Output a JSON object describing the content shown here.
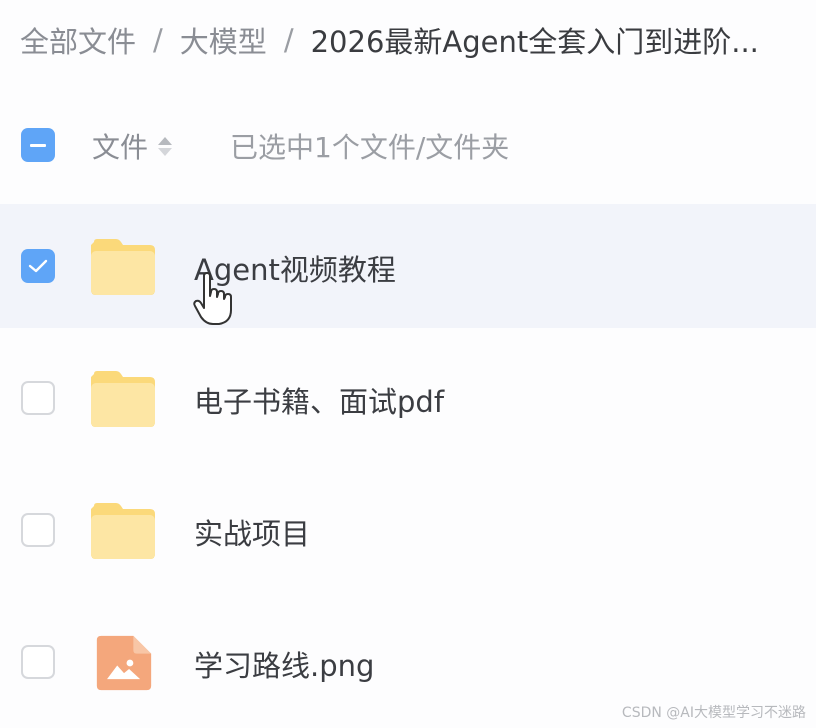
{
  "breadcrumb": {
    "items": [
      "全部文件",
      "大模型",
      "2026最新Agent全套入门到进阶..."
    ],
    "separator": "/"
  },
  "list_header": {
    "column_name": "文件",
    "selection_status": "已选中1个文件/文件夹"
  },
  "files": [
    {
      "name": "Agent视频教程",
      "type": "folder",
      "checked": true
    },
    {
      "name": "电子书籍、面试pdf",
      "type": "folder",
      "checked": false
    },
    {
      "name": "实战项目",
      "type": "folder",
      "checked": false
    },
    {
      "name": "学习路线.png",
      "type": "image",
      "checked": false
    }
  ],
  "watermark": "CSDN @AI大模型学习不迷路",
  "colors": {
    "accent": "#5fa5f7",
    "folder": "#fbd97a",
    "image_file": "#f4a77c",
    "selected_row": "#f2f4fa"
  }
}
